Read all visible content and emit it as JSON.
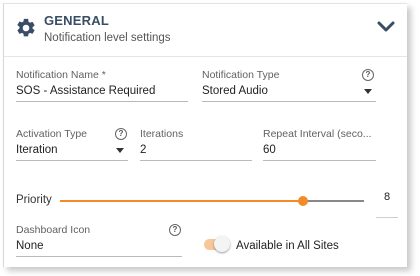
{
  "header": {
    "title": "GENERAL",
    "subtitle": "Notification level settings",
    "icon": "gear-icon",
    "collapse_icon": "chevron-down-icon",
    "title_color": "#3a4d66"
  },
  "fields": {
    "notification_name": {
      "label": "Notification Name *",
      "value": "SOS - Assistance Required"
    },
    "notification_type": {
      "label": "Notification Type",
      "value": "Stored Audio",
      "help": "?"
    },
    "activation_type": {
      "label": "Activation Type",
      "value": "Iteration",
      "help": "?"
    },
    "iterations": {
      "label": "Iterations",
      "value": "2"
    },
    "repeat_interval": {
      "label": "Repeat Interval (seco...",
      "value": "60"
    },
    "priority": {
      "label": "Priority",
      "value": "8",
      "fraction": 0.8
    },
    "dashboard_icon": {
      "label": "Dashboard Icon",
      "value": "None",
      "help": "?"
    }
  },
  "toggle": {
    "label": "Available in All Sites",
    "on": true,
    "accent": "#f28c28"
  }
}
